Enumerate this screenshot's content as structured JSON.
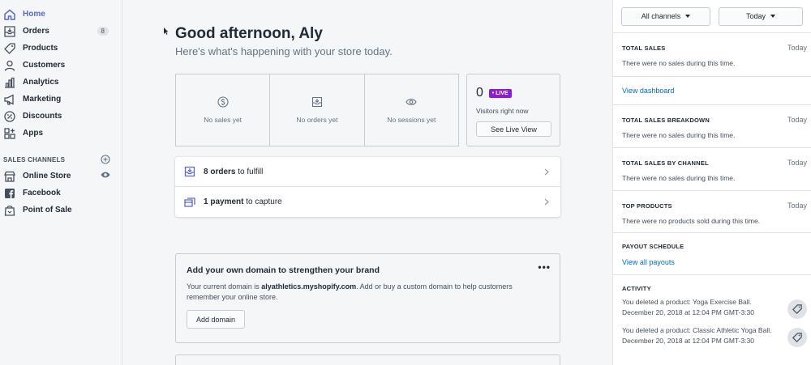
{
  "sidebar": {
    "items": [
      {
        "label": "Home",
        "icon": "home-icon"
      },
      {
        "label": "Orders",
        "icon": "orders-icon",
        "badge": "8"
      },
      {
        "label": "Products",
        "icon": "tag-icon"
      },
      {
        "label": "Customers",
        "icon": "person-icon"
      },
      {
        "label": "Analytics",
        "icon": "bar-chart-icon"
      },
      {
        "label": "Marketing",
        "icon": "megaphone-icon"
      },
      {
        "label": "Discounts",
        "icon": "discount-icon"
      },
      {
        "label": "Apps",
        "icon": "apps-icon"
      }
    ],
    "channels_heading": "SALES CHANNELS",
    "channels": [
      {
        "label": "Online Store",
        "icon": "store-icon"
      },
      {
        "label": "Facebook",
        "icon": "facebook-icon"
      },
      {
        "label": "Point of Sale",
        "icon": "pos-icon"
      }
    ]
  },
  "main": {
    "greeting": "Good afternoon, Aly",
    "subtitle": "Here's what's happening with your store today.",
    "stats": [
      "No sales yet",
      "No orders yet",
      "No sessions yet"
    ],
    "live": {
      "count": "0",
      "tag": "• LIVE",
      "label": "Visitors right now",
      "button": "See Live View"
    },
    "tasks": [
      {
        "bold": "8 orders",
        "rest": " to fulfill"
      },
      {
        "bold": "1 payment",
        "rest": " to capture"
      }
    ],
    "domain_card": {
      "title": "Add your own domain to strengthen your brand",
      "text_before": "Your current domain is ",
      "domain": "alyathletics.myshopify.com",
      "text_after": ". Add or buy a custom domain to help customers remember your online store.",
      "button": "Add domain",
      "menu": "•••"
    }
  },
  "right": {
    "channel_select": "All channels",
    "date_select": "Today",
    "total_sales": {
      "heading": "TOTAL SALES",
      "date": "Today",
      "text": "There were no sales during this time.",
      "link": "View dashboard"
    },
    "breakdown": {
      "heading": "TOTAL SALES BREAKDOWN",
      "date": "Today",
      "text": "There were no sales during this time."
    },
    "by_channel": {
      "heading": "TOTAL SALES BY CHANNEL",
      "date": "Today",
      "text": "There were no sales during this time."
    },
    "top_products": {
      "heading": "TOP PRODUCTS",
      "date": "Today",
      "text": "There were no products sold during this time."
    },
    "payout": {
      "heading": "PAYOUT SCHEDULE",
      "link": "View all payouts"
    },
    "activity": {
      "heading": "ACTIVITY",
      "items": [
        {
          "line1": "You deleted a product: Yoga Exercise Ball.",
          "line2": "December 20, 2018 at 12:04 PM GMT-3:30"
        },
        {
          "line1": "You deleted a product: Classic Athletic Yoga Ball.",
          "line2": "December 20, 2018 at 12:04 PM GMT-3:30"
        }
      ]
    }
  },
  "colors": {
    "accent": "#5c6ac4",
    "link": "#006fbb",
    "live": "#8e1bd1"
  }
}
